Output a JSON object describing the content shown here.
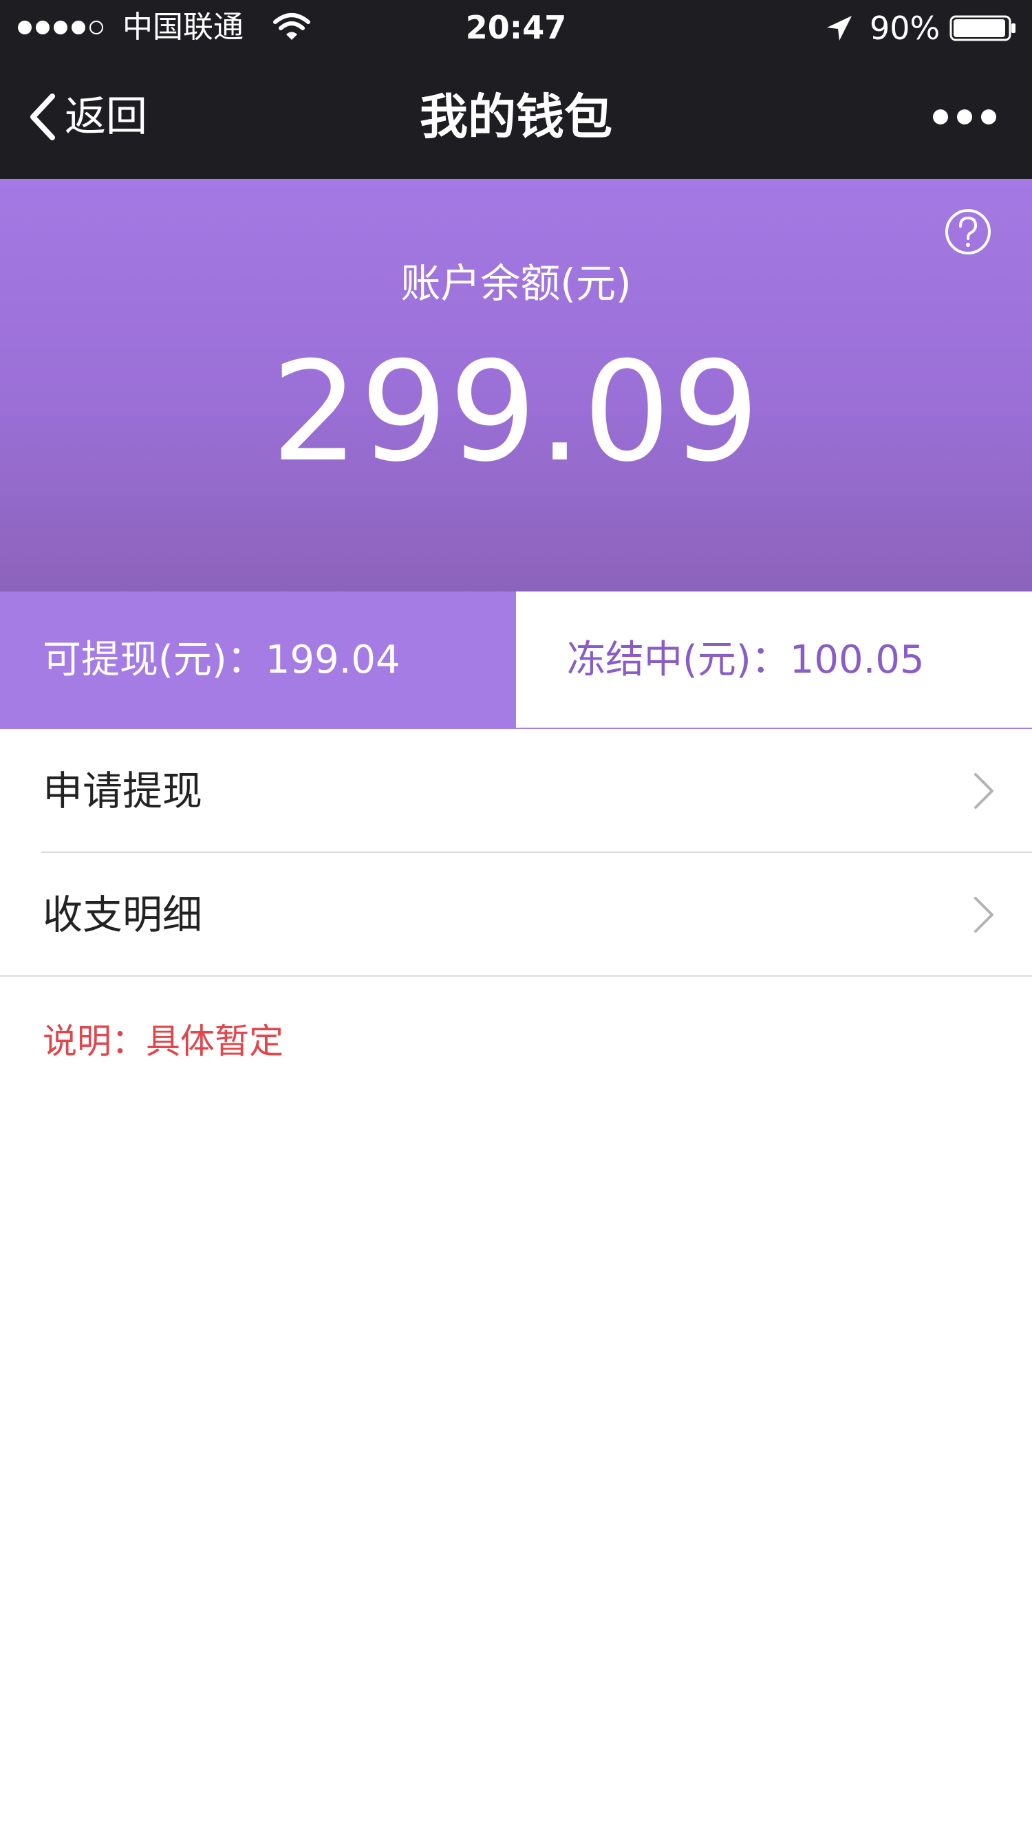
{
  "status_bar": {
    "carrier": "中国联通",
    "time": "20:47",
    "battery_percent": "90%",
    "battery_level": 0.9,
    "signal_bars_filled": 4,
    "signal_bars_total": 5
  },
  "nav": {
    "back_label": "返回",
    "title": "我的钱包"
  },
  "balance": {
    "label": "账户余额(元)",
    "value": "299.09"
  },
  "split": {
    "withdrawable": "可提现(元)：199.04",
    "frozen": "冻结中(元)：100.05"
  },
  "menu": {
    "items": [
      {
        "label": "申请提现"
      },
      {
        "label": "收支明细"
      }
    ]
  },
  "note": "说明：具体暂定",
  "colors": {
    "nav_background": "#1e1d22",
    "accent_purple": "#a57be4",
    "frozen_text": "#8a5cc6",
    "note_red": "#e0464c"
  }
}
